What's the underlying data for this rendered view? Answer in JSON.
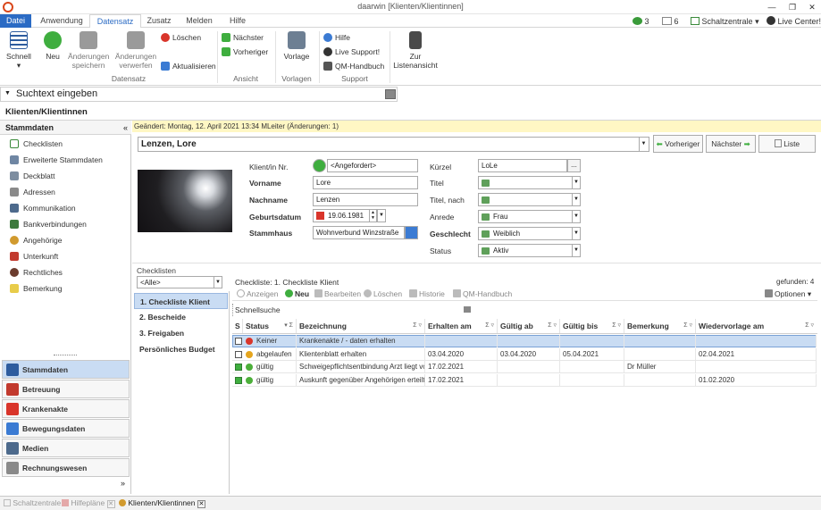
{
  "window": {
    "title": "daarwin [Klienten/Klientinnen]"
  },
  "tabs": [
    "Datei",
    "Anwendung",
    "Datensatz",
    "Zusatz",
    "Melden",
    "Hilfe"
  ],
  "quick": {
    "count_a": "3",
    "count_b": "6",
    "schaltzentrale": "Schaltzentrale",
    "live_center": "Live Center!"
  },
  "ribbon": {
    "schnell": "Schnell",
    "neu": "Neu",
    "aenderungen_speichern": "Änderungen speichern",
    "aenderungen_verwerfen": "Änderungen verwerfen",
    "loeschen": "Löschen",
    "aktualisieren": "Aktualisieren",
    "naechster": "Nächster",
    "vorheriger": "Vorheriger",
    "vorlage": "Vorlage",
    "hilfe": "Hilfe",
    "live_support": "Live Support!",
    "qm_handbuch": "QM-Handbuch",
    "zur_listenansicht": "Zur Listenansicht",
    "groups": {
      "datensatz": "Datensatz",
      "ansicht": "Ansicht",
      "vorlagen": "Vorlagen",
      "support": "Support"
    }
  },
  "search": {
    "placeholder": "Suchtext eingeben"
  },
  "page": {
    "title": "Klienten/Klientinnen"
  },
  "sidebar": {
    "header": "Stammdaten",
    "items": [
      "Checklisten",
      "Erweiterte Stammdaten",
      "Deckblatt",
      "Adressen",
      "Kommunikation",
      "Bankverbindungen",
      "Angehörige",
      "Unterkunft",
      "Rechtliches",
      "Bemerkung"
    ],
    "nav": [
      "Stammdaten",
      "Betreuung",
      "Krankenakte",
      "Bewegungsdaten",
      "Medien",
      "Rechnungswesen"
    ]
  },
  "record": {
    "changed": "Geändert: Montag, 12. April 2021 13:34  MLeiter  (Änderungen: 1)",
    "name": "Lenzen, Lore",
    "btn_prev": "Vorheriger",
    "btn_next": "Nächster",
    "btn_list": "Liste"
  },
  "form": {
    "labels": {
      "nr": "Klient/in Nr.",
      "vorname": "Vorname",
      "nachname": "Nachname",
      "geburtsdatum": "Geburtsdatum",
      "stammhaus": "Stammhaus",
      "kuerzel": "Kürzel",
      "titel": "Titel",
      "titel_nach": "Titel, nach",
      "anrede": "Anrede",
      "geschlecht": "Geschlecht",
      "status": "Status"
    },
    "values": {
      "nr": "<Angefordert>",
      "vorname": "Lore",
      "nachname": "Lenzen",
      "geburtsdatum": "19.06.1981",
      "stammhaus": "Wohnverbund Winzstraße",
      "kuerzel": "LoLe",
      "titel": "",
      "titel_nach": "",
      "anrede": "Frau",
      "geschlecht": "Weiblich",
      "status": "Aktiv"
    }
  },
  "checklists": {
    "header": "Checklisten",
    "filter": "<Alle>",
    "items": [
      "1. Checkliste Klient",
      "2. Bescheide",
      "3. Freigaben",
      "Persönliches Budget"
    ],
    "title": "Checkliste: 1. Checkliste Klient",
    "found": "gefunden: 4",
    "toolbar": [
      "Anzeigen",
      "Neu",
      "Bearbeiten",
      "Löschen",
      "Historie",
      "QM-Handbuch",
      "Optionen"
    ],
    "quick_search": "Schnellsuche",
    "columns": [
      "S",
      "Status",
      "Bezeichnung",
      "Erhalten am",
      "Gültig ab",
      "Gültig bis",
      "Bemerkung",
      "Wiedervorlage am"
    ],
    "rows": [
      {
        "status": "Keiner",
        "bezeichnung": "Krankenakte / - daten erhalten",
        "erhalten": "",
        "gueltig_ab": "",
        "gueltig_bis": "",
        "bemerkung": "",
        "wiedervorlage": "",
        "color": "#d9352b"
      },
      {
        "status": "abgelaufen",
        "bezeichnung": "Klientenblatt erhalten",
        "erhalten": "03.04.2020",
        "gueltig_ab": "03.04.2020",
        "gueltig_bis": "05.04.2021",
        "bemerkung": "",
        "wiedervorlage": "02.04.2021",
        "color": "#e5a51e"
      },
      {
        "status": "gültig",
        "bezeichnung": "Schweigepflichtsentbindung Arzt liegt vo",
        "erhalten": "17.02.2021",
        "gueltig_ab": "",
        "gueltig_bis": "",
        "bemerkung": "Dr Müller",
        "wiedervorlage": "",
        "color": "#4caf3a"
      },
      {
        "status": "gültig",
        "bezeichnung": "Auskunft gegenüber Angehörigen erteilt",
        "erhalten": "17.02.2021",
        "gueltig_ab": "",
        "gueltig_bis": "",
        "bemerkung": "",
        "wiedervorlage": "01.02.2020",
        "color": "#4caf3a"
      }
    ]
  },
  "statusbar": [
    "Schaltzentrale",
    "Hilfepläne",
    "Klienten/Klientinnen"
  ]
}
